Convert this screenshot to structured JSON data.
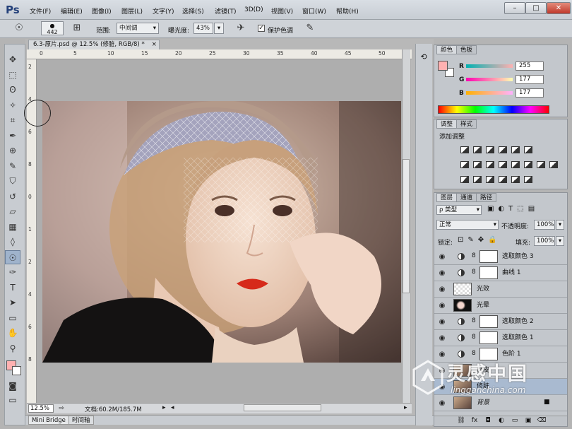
{
  "app": {
    "logo": "Ps"
  },
  "menu": [
    "文件(F)",
    "编辑(E)",
    "图像(I)",
    "图层(L)",
    "文字(Y)",
    "选择(S)",
    "滤镜(T)",
    "3D(D)",
    "视图(V)",
    "窗口(W)",
    "帮助(H)"
  ],
  "window_controls": {
    "minimize": "–",
    "maximize": "□",
    "close": "✕"
  },
  "options": {
    "brush_size": "442",
    "range_label": "范围:",
    "range_value": "中间调",
    "exposure_label": "曝光度:",
    "exposure_value": "43%",
    "protect_tone_label": "保护色调",
    "protect_tone_checked": true
  },
  "document": {
    "tab_title": "6.3-原片.psd @ 12.5% (修脏, RGB/8) *",
    "ruler_top": [
      "0",
      "5",
      "10",
      "15",
      "20",
      "25",
      "30",
      "35",
      "40",
      "45",
      "50"
    ],
    "ruler_left": [
      "2",
      "4",
      "6",
      "8",
      "0",
      "1",
      "2",
      "4",
      "6",
      "8"
    ],
    "zoom": "12.5%",
    "doc_info": "文档:60.2M/185.7M"
  },
  "bottom_tabs": [
    "Mini Bridge",
    "时间轴"
  ],
  "color_panel": {
    "tabs": [
      "颜色",
      "色板"
    ],
    "r_label": "R",
    "r_value": "255",
    "g_label": "G",
    "g_value": "177",
    "b_label": "B",
    "b_value": "177",
    "foreground": "#ffb1b1"
  },
  "adjust_panel": {
    "tabs": [
      "调整",
      "样式"
    ],
    "title": "添加调整"
  },
  "layers_panel": {
    "tabs": [
      "图层",
      "通道",
      "路径"
    ],
    "filter_label": "ρ 类型",
    "blend_mode": "正常",
    "opacity_label": "不透明度:",
    "opacity_value": "100%",
    "lock_label": "锁定:",
    "fill_label": "填充:",
    "fill_value": "100%",
    "layers": [
      {
        "name": "选取颜色 3",
        "type": "adjust",
        "selected": false
      },
      {
        "name": "曲线 1",
        "type": "adjust",
        "selected": false
      },
      {
        "name": "光效",
        "type": "checker",
        "selected": false
      },
      {
        "name": "光晕",
        "type": "dark",
        "selected": false
      },
      {
        "name": "选取颜色 2",
        "type": "adjust",
        "selected": false
      },
      {
        "name": "选取颜色 1",
        "type": "adjust",
        "selected": false
      },
      {
        "name": "色阶 1",
        "type": "adjust",
        "selected": false
      },
      {
        "name": "磨皮",
        "type": "photo",
        "selected": false
      },
      {
        "name": "修脏",
        "type": "photo",
        "selected": true
      },
      {
        "name": "背景",
        "type": "photo",
        "selected": false,
        "locked": true
      }
    ],
    "footer_icons": [
      "link-icon",
      "fx-icon",
      "mask-icon",
      "adjustment-icon",
      "folder-icon",
      "new-layer-icon",
      "trash-icon"
    ]
  },
  "watermark": {
    "brand": "灵感中国",
    "url": "lingganchina.com"
  }
}
